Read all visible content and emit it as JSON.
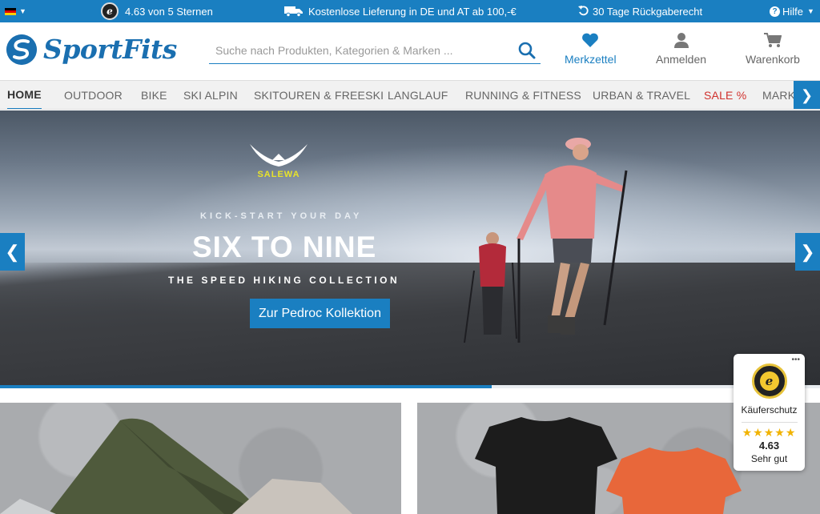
{
  "topbar": {
    "rating_text": "4.63 von 5 Sternen",
    "delivery_text": "Kostenlose Lieferung in DE und AT ab 100,-€",
    "return_text": "30 Tage Rückgaberecht",
    "help_label": "Hilfe"
  },
  "header": {
    "logo_text": "SportFits",
    "search_placeholder": "Suche nach Produkten, Kategorien & Marken ...",
    "favorites_label": "Merkzettel",
    "login_label": "Anmelden",
    "cart_label": "Warenkorb"
  },
  "nav": {
    "items": [
      "HOME",
      "OUTDOOR",
      "BIKE",
      "SKI ALPIN",
      "SKITOUREN & FREESKI",
      "LANGLAUF",
      "RUNNING & FITNESS",
      "URBAN & TRAVEL",
      "SALE %",
      "MARKEN"
    ]
  },
  "hero": {
    "brand": "SALEWA",
    "kicker": "KICK-START YOUR DAY",
    "headline": "SIX TO NINE",
    "subline": "THE SPEED HIKING COLLECTION",
    "cta_label": "Zur Pedroc Kollektion",
    "progress": 0.6
  },
  "trust_widget": {
    "label": "Käuferschutz",
    "stars": "★★★★★",
    "score": "4.63",
    "verdict": "Sehr gut"
  },
  "colors": {
    "brand_blue": "#1a7fc1",
    "sale_red": "#d0312d",
    "star_gold": "#f1b300"
  }
}
